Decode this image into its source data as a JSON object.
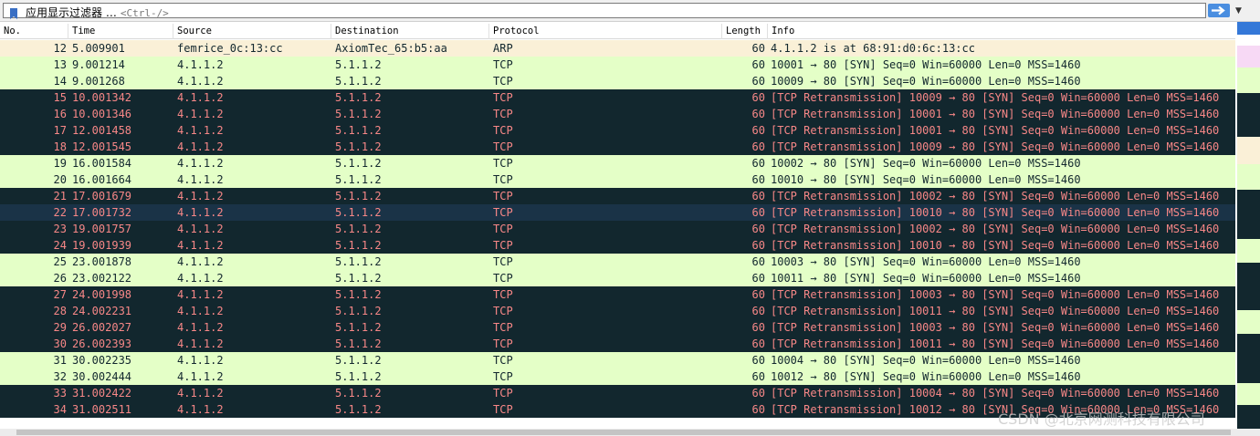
{
  "filter": {
    "label": "应用显示过滤器 …",
    "hint": "<Ctrl-/>"
  },
  "columns": {
    "no": "No.",
    "time": "Time",
    "source": "Source",
    "destination": "Destination",
    "protocol": "Protocol",
    "length": "Length",
    "info": "Info"
  },
  "colors": {
    "arp_bg": "#faf0d7",
    "tcp_bg": "#e4ffc7",
    "retrans_bg": "#12272e",
    "retrans_fg": "#f78787",
    "selected_bg": "#1a3347",
    "normal_fg": "#12272e"
  },
  "packets": [
    {
      "no": "12",
      "time": "5.009901",
      "src": "femrice_0c:13:cc",
      "dst": "AxiomTec_65:b5:aa",
      "proto": "ARP",
      "len": "60",
      "info": "4.1.1.2 is at 68:91:d0:6c:13:cc",
      "style": "arp"
    },
    {
      "no": "13",
      "time": "9.001214",
      "src": "4.1.1.2",
      "dst": "5.1.1.2",
      "proto": "TCP",
      "len": "60",
      "info": "10001 → 80 [SYN] Seq=0 Win=60000 Len=0 MSS=1460",
      "style": "tcp"
    },
    {
      "no": "14",
      "time": "9.001268",
      "src": "4.1.1.2",
      "dst": "5.1.1.2",
      "proto": "TCP",
      "len": "60",
      "info": "10009 → 80 [SYN] Seq=0 Win=60000 Len=0 MSS=1460",
      "style": "tcp"
    },
    {
      "no": "15",
      "time": "10.001342",
      "src": "4.1.1.2",
      "dst": "5.1.1.2",
      "proto": "TCP",
      "len": "60",
      "info": "[TCP Retransmission] 10009 → 80 [SYN] Seq=0 Win=60000 Len=0 MSS=1460",
      "style": "retrans"
    },
    {
      "no": "16",
      "time": "10.001346",
      "src": "4.1.1.2",
      "dst": "5.1.1.2",
      "proto": "TCP",
      "len": "60",
      "info": "[TCP Retransmission] 10001 → 80 [SYN] Seq=0 Win=60000 Len=0 MSS=1460",
      "style": "retrans"
    },
    {
      "no": "17",
      "time": "12.001458",
      "src": "4.1.1.2",
      "dst": "5.1.1.2",
      "proto": "TCP",
      "len": "60",
      "info": "[TCP Retransmission] 10001 → 80 [SYN] Seq=0 Win=60000 Len=0 MSS=1460",
      "style": "retrans"
    },
    {
      "no": "18",
      "time": "12.001545",
      "src": "4.1.1.2",
      "dst": "5.1.1.2",
      "proto": "TCP",
      "len": "60",
      "info": "[TCP Retransmission] 10009 → 80 [SYN] Seq=0 Win=60000 Len=0 MSS=1460",
      "style": "retrans"
    },
    {
      "no": "19",
      "time": "16.001584",
      "src": "4.1.1.2",
      "dst": "5.1.1.2",
      "proto": "TCP",
      "len": "60",
      "info": "10002 → 80 [SYN] Seq=0 Win=60000 Len=0 MSS=1460",
      "style": "tcp"
    },
    {
      "no": "20",
      "time": "16.001664",
      "src": "4.1.1.2",
      "dst": "5.1.1.2",
      "proto": "TCP",
      "len": "60",
      "info": "10010 → 80 [SYN] Seq=0 Win=60000 Len=0 MSS=1460",
      "style": "tcp"
    },
    {
      "no": "21",
      "time": "17.001679",
      "src": "4.1.1.2",
      "dst": "5.1.1.2",
      "proto": "TCP",
      "len": "60",
      "info": "[TCP Retransmission] 10002 → 80 [SYN] Seq=0 Win=60000 Len=0 MSS=1460",
      "style": "retrans"
    },
    {
      "no": "22",
      "time": "17.001732",
      "src": "4.1.1.2",
      "dst": "5.1.1.2",
      "proto": "TCP",
      "len": "60",
      "info": "[TCP Retransmission] 10010 → 80 [SYN] Seq=0 Win=60000 Len=0 MSS=1460",
      "style": "selected"
    },
    {
      "no": "23",
      "time": "19.001757",
      "src": "4.1.1.2",
      "dst": "5.1.1.2",
      "proto": "TCP",
      "len": "60",
      "info": "[TCP Retransmission] 10002 → 80 [SYN] Seq=0 Win=60000 Len=0 MSS=1460",
      "style": "retrans"
    },
    {
      "no": "24",
      "time": "19.001939",
      "src": "4.1.1.2",
      "dst": "5.1.1.2",
      "proto": "TCP",
      "len": "60",
      "info": "[TCP Retransmission] 10010 → 80 [SYN] Seq=0 Win=60000 Len=0 MSS=1460",
      "style": "retrans"
    },
    {
      "no": "25",
      "time": "23.001878",
      "src": "4.1.1.2",
      "dst": "5.1.1.2",
      "proto": "TCP",
      "len": "60",
      "info": "10003 → 80 [SYN] Seq=0 Win=60000 Len=0 MSS=1460",
      "style": "tcp"
    },
    {
      "no": "26",
      "time": "23.002122",
      "src": "4.1.1.2",
      "dst": "5.1.1.2",
      "proto": "TCP",
      "len": "60",
      "info": "10011 → 80 [SYN] Seq=0 Win=60000 Len=0 MSS=1460",
      "style": "tcp"
    },
    {
      "no": "27",
      "time": "24.001998",
      "src": "4.1.1.2",
      "dst": "5.1.1.2",
      "proto": "TCP",
      "len": "60",
      "info": "[TCP Retransmission] 10003 → 80 [SYN] Seq=0 Win=60000 Len=0 MSS=1460",
      "style": "retrans"
    },
    {
      "no": "28",
      "time": "24.002231",
      "src": "4.1.1.2",
      "dst": "5.1.1.2",
      "proto": "TCP",
      "len": "60",
      "info": "[TCP Retransmission] 10011 → 80 [SYN] Seq=0 Win=60000 Len=0 MSS=1460",
      "style": "retrans"
    },
    {
      "no": "29",
      "time": "26.002027",
      "src": "4.1.1.2",
      "dst": "5.1.1.2",
      "proto": "TCP",
      "len": "60",
      "info": "[TCP Retransmission] 10003 → 80 [SYN] Seq=0 Win=60000 Len=0 MSS=1460",
      "style": "retrans"
    },
    {
      "no": "30",
      "time": "26.002393",
      "src": "4.1.1.2",
      "dst": "5.1.1.2",
      "proto": "TCP",
      "len": "60",
      "info": "[TCP Retransmission] 10011 → 80 [SYN] Seq=0 Win=60000 Len=0 MSS=1460",
      "style": "retrans"
    },
    {
      "no": "31",
      "time": "30.002235",
      "src": "4.1.1.2",
      "dst": "5.1.1.2",
      "proto": "TCP",
      "len": "60",
      "info": "10004 → 80 [SYN] Seq=0 Win=60000 Len=0 MSS=1460",
      "style": "tcp"
    },
    {
      "no": "32",
      "time": "30.002444",
      "src": "4.1.1.2",
      "dst": "5.1.1.2",
      "proto": "TCP",
      "len": "60",
      "info": "10012 → 80 [SYN] Seq=0 Win=60000 Len=0 MSS=1460",
      "style": "tcp"
    },
    {
      "no": "33",
      "time": "31.002422",
      "src": "4.1.1.2",
      "dst": "5.1.1.2",
      "proto": "TCP",
      "len": "60",
      "info": "[TCP Retransmission] 10004 → 80 [SYN] Seq=0 Win=60000 Len=0 MSS=1460",
      "style": "retrans"
    },
    {
      "no": "34",
      "time": "31.002511",
      "src": "4.1.1.2",
      "dst": "5.1.1.2",
      "proto": "TCP",
      "len": "60",
      "info": "[TCP Retransmission] 10012 → 80 [SYN] Seq=0 Win=60000 Len=0 MSS=1460",
      "style": "retrans"
    }
  ],
  "watermark": "CSDN @北京网测科技有限公司"
}
